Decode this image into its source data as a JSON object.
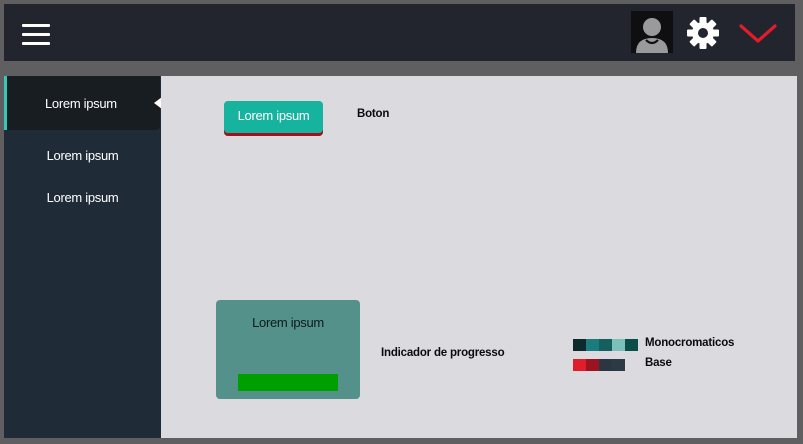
{
  "header": {
    "menu_icon": "hamburger-menu-icon",
    "avatar_icon": "user-avatar-icon",
    "settings_icon": "gear-icon",
    "dropdown_icon": "chevron-down-icon",
    "dropdown_color": "#e01e2b"
  },
  "sidebar": {
    "accent": "#39c7b5",
    "items": [
      {
        "label": "Lorem ipsum",
        "active": true
      },
      {
        "label": "Lorem ipsum",
        "active": false
      },
      {
        "label": "Lorem ipsum",
        "active": false
      }
    ]
  },
  "main": {
    "button": {
      "label": "Lorem ipsum",
      "color": "#16b39f",
      "underline_color": "#a4111d"
    },
    "button_caption": "Boton",
    "progress": {
      "title": "Lorem ipsum",
      "value": 1.0,
      "fill_color": "#009f00",
      "card_color": "#55918b"
    },
    "progress_caption": "Indicador de progresso",
    "palettes": [
      {
        "label": "Monocromaticos",
        "colors": [
          "#0d2b2d",
          "#1b7c7e",
          "#15605f",
          "#7cc0ba",
          "#0a4d49"
        ]
      },
      {
        "label": "Base",
        "colors": [
          "#e01e2b",
          "#9b1420",
          "#2a3641",
          "#2c3a45"
        ]
      }
    ]
  }
}
